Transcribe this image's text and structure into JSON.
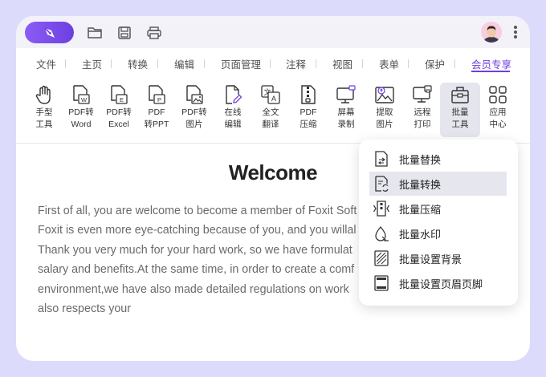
{
  "menubar": {
    "items": [
      "文件",
      "主页",
      "转换",
      "编辑",
      "页面管理",
      "注释",
      "视图",
      "表单",
      "保护",
      "会员专享"
    ],
    "active": "会员专享"
  },
  "toolbar": {
    "tools": [
      {
        "line1": "手型",
        "line2": "工具",
        "icon": "hand-icon"
      },
      {
        "line1": "PDF转",
        "line2": "Word",
        "icon": "pdf-to-word-icon"
      },
      {
        "line1": "PDF转",
        "line2": "Excel",
        "icon": "pdf-to-excel-icon"
      },
      {
        "line1": "PDF",
        "line2": "转PPT",
        "icon": "pdf-to-ppt-icon"
      },
      {
        "line1": "PDF转",
        "line2": "图片",
        "icon": "pdf-to-image-icon"
      },
      {
        "line1": "在线",
        "line2": "编辑",
        "icon": "online-edit-icon"
      },
      {
        "line1": "全文",
        "line2": "翻译",
        "icon": "translate-icon"
      },
      {
        "line1": "PDF",
        "line2": "压缩",
        "icon": "compress-icon"
      },
      {
        "line1": "屏幕",
        "line2": "录制",
        "icon": "screen-record-icon"
      },
      {
        "line1": "提取",
        "line2": "图片",
        "icon": "extract-image-icon"
      },
      {
        "line1": "远程",
        "line2": "打印",
        "icon": "remote-print-icon"
      },
      {
        "line1": "批量",
        "line2": "工具",
        "icon": "batch-tools-icon"
      },
      {
        "line1": "应用",
        "line2": "中心",
        "icon": "app-center-icon"
      }
    ],
    "selected": "批量工具"
  },
  "document": {
    "title": "Welcome",
    "lines": [
      "First of all, you are welcome to become a member of Foxit Soft",
      "Foxit is even more eye-catching because of you, and you willal",
      "Thank you very much for your hard work, so we have formulat",
      "salary and benefits.At the same time, in order to create a comf",
      "environment,we have also made detailed regulations on work",
      "also respects your"
    ]
  },
  "dropdown": {
    "items": [
      {
        "label": "批量替换",
        "icon": "batch-replace-icon"
      },
      {
        "label": "批量转换",
        "icon": "batch-convert-icon"
      },
      {
        "label": "批量压缩",
        "icon": "batch-compress-icon"
      },
      {
        "label": "批量水印",
        "icon": "batch-watermark-icon"
      },
      {
        "label": "批量设置背景",
        "icon": "batch-background-icon"
      },
      {
        "label": "批量设置页眉页脚",
        "icon": "batch-header-footer-icon"
      }
    ],
    "hovered": "批量转换"
  },
  "colors": {
    "accent": "#6d3fe0",
    "frame": "#dcdbfb",
    "titlebar": "#f3f2f9"
  }
}
